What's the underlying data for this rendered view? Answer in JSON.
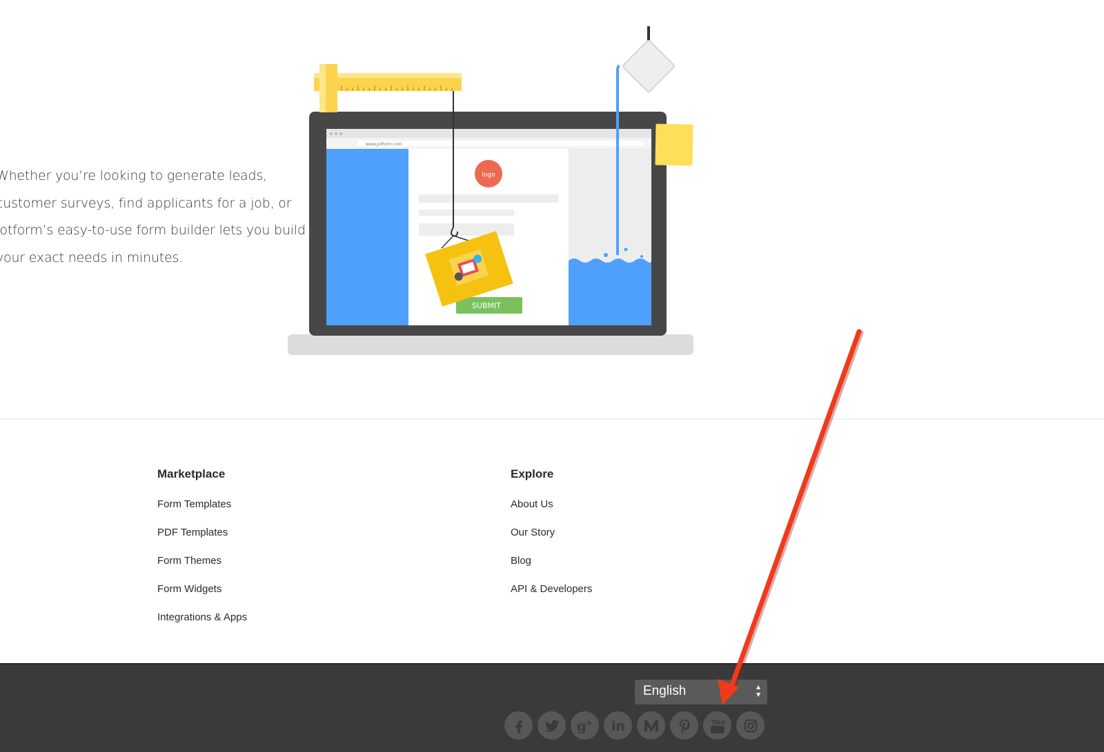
{
  "intro": {
    "lines": [
      "Whether you’re looking to generate leads,",
      "customer surveys, find applicants for a job, or",
      "Jotform’s easy-to-use form builder lets you build",
      "your exact needs in minutes."
    ]
  },
  "illustration": {
    "url": "www.jotform.com",
    "logo_label": "logo",
    "submit_label": "SUBMIT"
  },
  "footer_columns": [
    {
      "heading": "Marketplace",
      "links": [
        "Form Templates",
        "PDF Templates",
        "Form Themes",
        "Form Widgets",
        "Integrations & Apps"
      ]
    },
    {
      "heading": "Explore",
      "links": [
        "About Us",
        "Our Story",
        "Blog",
        "API & Developers"
      ]
    }
  ],
  "language_select": {
    "selected": "English"
  },
  "social_icons": [
    "facebook-icon",
    "twitter-icon",
    "google-plus-icon",
    "linkedin-icon",
    "medium-icon",
    "pinterest-icon",
    "youtube-icon",
    "instagram-icon"
  ],
  "colors": {
    "footer_bg": "#3a3a3a",
    "icon_bg": "#575757",
    "annotation": "#f13a1c",
    "submit": "#7ac15e",
    "blue": "#4fa0fc"
  }
}
